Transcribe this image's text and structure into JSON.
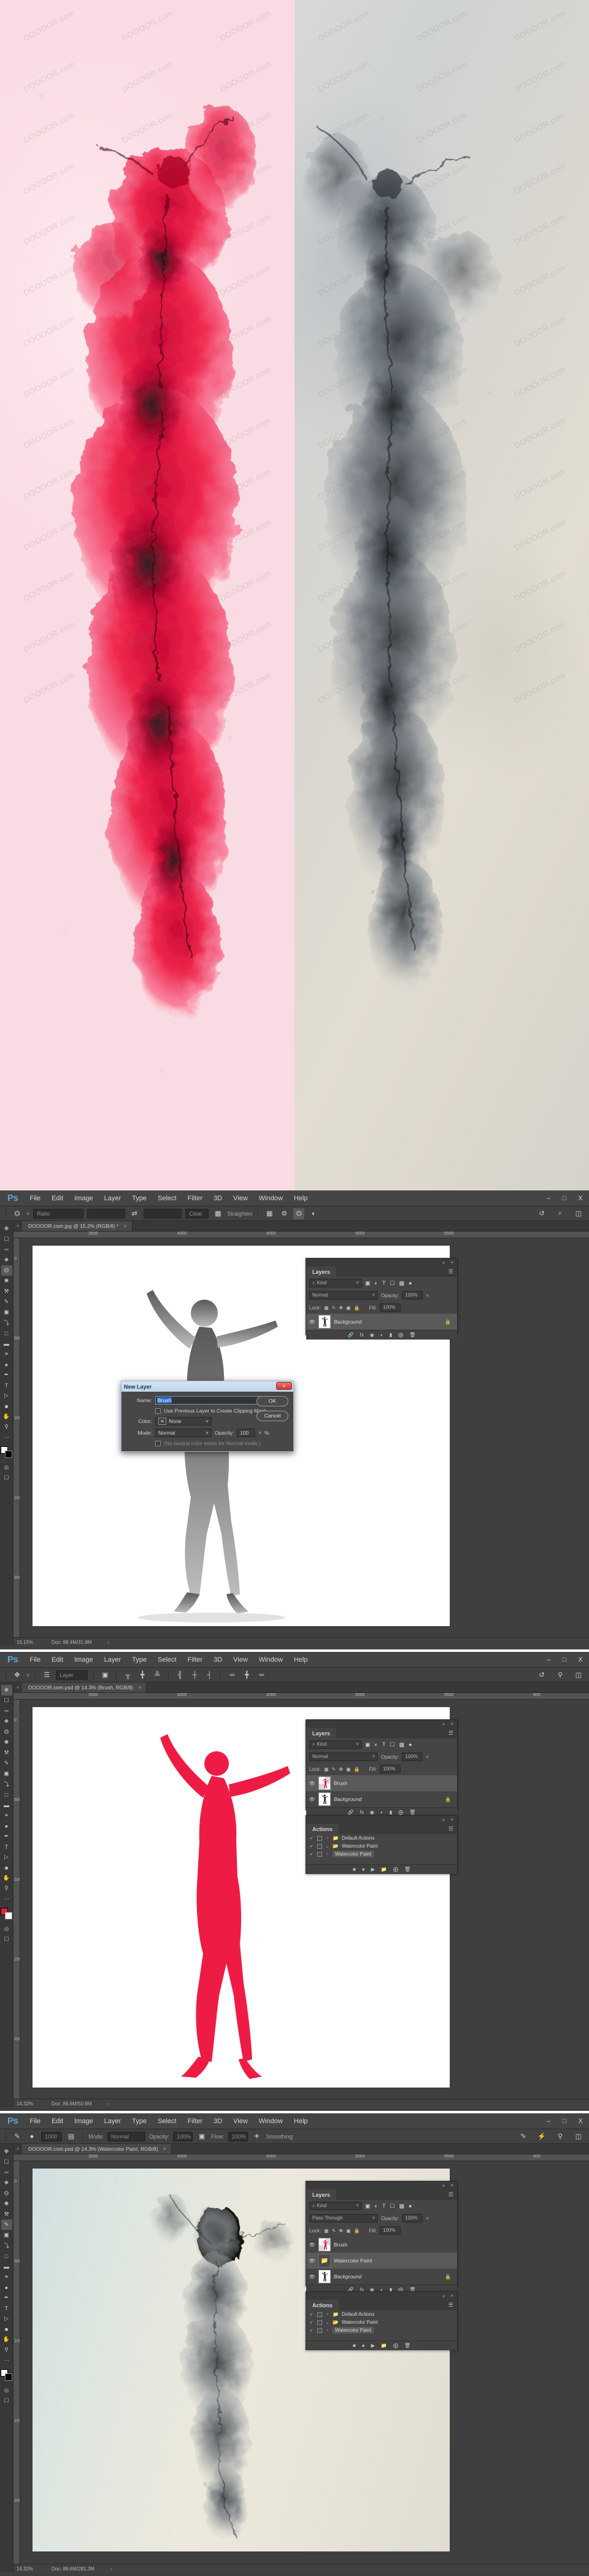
{
  "hero": {
    "watermark_text": "DOOOOR.com",
    "left_panel_name": "watercolor-red-dancer",
    "right_panel_name": "watercolor-gray-dancer",
    "colors": {
      "red": "#ee1c44",
      "pink_bg": "#fadde4",
      "gray_bg": "#d8d6cd",
      "dark": "#3a3a3a"
    }
  },
  "menubar": {
    "logo": "Ps",
    "items": [
      "File",
      "Edit",
      "Image",
      "Layer",
      "Type",
      "Select",
      "Filter",
      "3D",
      "View",
      "Window",
      "Help"
    ],
    "window_controls": [
      "–",
      "□",
      "X"
    ]
  },
  "window1": {
    "tab": "DOOOOR.com.jpg @ 15.2% (RGB/8) *",
    "tab_close": "×",
    "options": {
      "tool_icon": "crop-tool-icon",
      "ratio_placeholder": "Ratio",
      "width_value": "",
      "height_value": "",
      "swap_icon": "⇄",
      "clear_label": "Clear",
      "straighten_label": "Straighten",
      "grid_icon": "overlay-grid-icon",
      "gear_icon": "⚙",
      "delete_cropped_icon": "delete-cropped-pixels-icon",
      "content_aware_icon": "content-aware-icon",
      "reset_icon": "↺",
      "search_icon": "⌕",
      "workspace_icon": "workspace-icon"
    },
    "rulers_h": [
      "3500",
      "4000",
      "4500",
      "5000",
      "5500"
    ],
    "rulers_v": [
      "0",
      "500",
      "1000",
      "1500",
      "2000"
    ],
    "layers_panel": {
      "title": "Layers",
      "collapse_icon": "«",
      "close_icon": "×",
      "menu_icon": "☰",
      "kind_placeholder": "Kind",
      "search_icon": "⌕",
      "filter_icons": [
        "pixel-filter-icon",
        "adjustment-filter-icon",
        "type-filter-icon",
        "shape-filter-icon",
        "smart-object-filter-icon"
      ],
      "toggle_icon": "filter-toggle-icon",
      "blend_mode": "Normal",
      "opacity_label": "Opacity:",
      "opacity_value": "100%",
      "lock_label": "Lock:",
      "lock_icons": [
        "lock-transparency-icon",
        "lock-image-icon",
        "lock-position-icon",
        "lock-artboard-icon",
        "lock-all-icon"
      ],
      "fill_label": "Fill:",
      "fill_value": "100%",
      "layers": [
        {
          "name": "Background",
          "italic": true,
          "locked": true,
          "visible": true,
          "thumb": "gray-dancer-thumb",
          "selected": true
        }
      ],
      "footer_icons": [
        "link-icon",
        "fx-icon",
        "mask-icon",
        "adjustment-icon",
        "group-icon",
        "new-layer-icon",
        "delete-icon"
      ]
    },
    "dialog": {
      "title": "New Layer",
      "close_label": "x",
      "name_label": "Name:",
      "name_value": "Brush",
      "clipping_checkbox_label": "Use Previous Layer to Create Clipping Mask",
      "color_label": "Color:",
      "color_value": "None",
      "color_swatch_icon": "✕",
      "mode_label": "Mode:",
      "mode_value": "Normal",
      "opacity_label": "Opacity:",
      "opacity_value": "100",
      "percent": "%",
      "neutral_note": "(No neutral color exists for Normal mode.)",
      "ok_label": "OK",
      "cancel_label": "Cancel"
    },
    "status": {
      "zoom": "15.15%",
      "doc": "Doc: 88.4M/31.9M",
      "arrows": "›"
    }
  },
  "window2": {
    "tab": "DOOOOR.com.psd @ 14.3% (Brush, RGB/8)",
    "tab_close": "×",
    "options": {
      "tool_icon": "move-tool-icon",
      "auto_select_icon": "auto-select-icon",
      "auto_select_value": "Layer",
      "transform_controls_icon": "show-transform-controls-icon",
      "align_icons": [
        "align-top-icon",
        "align-vertical-center-icon",
        "align-bottom-icon",
        "align-left-icon",
        "align-horizontal-center-icon",
        "align-right-icon"
      ],
      "distribute_icons": [
        "distribute-top-icon",
        "distribute-vertical-center-icon",
        "distribute-bottom-icon"
      ]
    },
    "rulers_h": [
      "3500",
      "4000",
      "4500",
      "5000",
      "5500",
      "600"
    ],
    "rulers_v": [
      "0",
      "500",
      "1000",
      "1500",
      "2000"
    ],
    "layers_panel": {
      "title": "Layers",
      "collapse_icon": "«",
      "close_icon": "×",
      "menu_icon": "☰",
      "kind_placeholder": "Kind",
      "search_icon": "⌕",
      "blend_mode": "Normal",
      "opacity_label": "Opacity:",
      "opacity_value": "100%",
      "lock_label": "Lock:",
      "fill_label": "Fill:",
      "fill_value": "100%",
      "layers": [
        {
          "name": "Brush",
          "italic": false,
          "locked": false,
          "visible": true,
          "thumb": "red-dancer-thumb",
          "selected": true
        },
        {
          "name": "Background",
          "italic": true,
          "locked": true,
          "visible": true,
          "thumb": "gray-dancer-thumb",
          "selected": false
        }
      ]
    },
    "actions_panel": {
      "title": "Actions",
      "collapse_icon": "«",
      "close_icon": "×",
      "menu_icon": "☰",
      "rows": [
        {
          "check": "✓",
          "box": "minus",
          "arrow": "›",
          "folder": true,
          "name": "Default Actions",
          "selected": false
        },
        {
          "check": "✓",
          "box": "empty",
          "arrow": "⌄",
          "folder": true,
          "name": "Watercolor Paint",
          "selected": false
        },
        {
          "check": "✓",
          "box": "empty",
          "arrow": "›",
          "folder": false,
          "name": "Watercolor Paint",
          "selected": true
        }
      ],
      "footer_icons": [
        "stop-icon",
        "record-icon",
        "play-icon",
        "new-set-icon",
        "new-action-icon",
        "delete-icon"
      ]
    },
    "status": {
      "zoom": "14.32%",
      "doc": "Doc: 86.6M/50.8M",
      "arrows": "›"
    }
  },
  "window3": {
    "tab": "DOOOOR.com.psd @ 14.3% (Watercolor Paint, RGB/8)",
    "tab_close": "×",
    "options": {
      "tool_icon": "brush-tool-icon",
      "brush_size": "1000",
      "mode_label": "Mode:",
      "mode_value": "Normal",
      "opacity_label": "Opacity:",
      "opacity_value": "100%",
      "flow_label": "Flow:",
      "flow_value": "100%",
      "airbrush_icon": "airbrush-icon",
      "smoothing_label": "Smoothing:",
      "tablet_pressure_icon": "tablet-pressure-icon"
    },
    "rulers_h": [
      "3500",
      "4000",
      "4500",
      "5000",
      "5500",
      "600"
    ],
    "rulers_v": [
      "0",
      "500",
      "1000",
      "1500",
      "2000"
    ],
    "layers_panel": {
      "title": "Layers",
      "collapse_icon": "«",
      "close_icon": "×",
      "menu_icon": "☰",
      "kind_placeholder": "Kind",
      "search_icon": "⌕",
      "blend_mode": "Pass Through",
      "opacity_label": "Opacity:",
      "opacity_value": "100%",
      "lock_label": "Lock:",
      "fill_label": "Fill:",
      "fill_value": "100%",
      "layers": [
        {
          "name": "Brush",
          "italic": false,
          "locked": false,
          "visible": true,
          "thumb": "red-dancer-thumb",
          "selected": false
        },
        {
          "name": "Watercolor Paint",
          "italic": false,
          "locked": false,
          "visible": true,
          "thumb": "group-thumb",
          "selected": true
        },
        {
          "name": "Background",
          "italic": true,
          "locked": true,
          "visible": true,
          "thumb": "gray-dancer-thumb",
          "selected": false
        }
      ]
    },
    "actions_panel": {
      "title": "Actions",
      "collapse_icon": "«",
      "close_icon": "×",
      "menu_icon": "☰",
      "rows": [
        {
          "check": "✓",
          "box": "minus",
          "arrow": "›",
          "folder": true,
          "name": "Default Actions",
          "selected": false
        },
        {
          "check": "✓",
          "box": "empty",
          "arrow": "⌄",
          "folder": true,
          "name": "Watercolor Paint",
          "selected": false
        },
        {
          "check": "✓",
          "box": "empty",
          "arrow": "›",
          "folder": false,
          "name": "Watercolor Paint",
          "selected": true
        }
      ]
    },
    "status": {
      "zoom": "14.32%",
      "doc": "Doc: 86.6M/281.3M",
      "arrows": "›"
    }
  }
}
